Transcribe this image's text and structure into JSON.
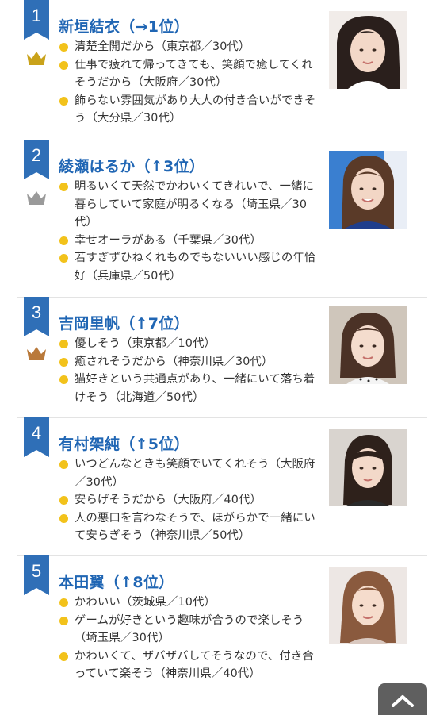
{
  "ranking": [
    {
      "rank": "1",
      "name": "新垣結衣（→1位）",
      "crown": "gold-crown-icon",
      "crown_color": "#c9a21a",
      "photo": "portrait-photo-1",
      "reasons": [
        "清楚全開だから（東京都／30代）",
        "仕事で疲れて帰ってきても、笑顔で癒してくれそうだから（大阪府／30代）",
        "飾らない雰囲気があり大人の付き合いができそう（大分県／30代）"
      ]
    },
    {
      "rank": "2",
      "name": "綾瀬はるか（↑3位）",
      "crown": "silver-crown-icon",
      "crown_color": "#9a9a9a",
      "photo": "portrait-photo-2",
      "reasons": [
        "明るいくて天然でかわいくてきれいで、一緒に暮らしていて家庭が明るくなる（埼玉県／30代）",
        "幸せオーラがある（千葉県／30代）",
        "若すぎずひねくれものでもないいい感じの年恰好（兵庫県／50代）"
      ]
    },
    {
      "rank": "3",
      "name": "吉岡里帆（↑7位）",
      "crown": "bronze-crown-icon",
      "crown_color": "#b9793a",
      "photo": "portrait-photo-3",
      "reasons": [
        "優しそう（東京都／10代）",
        "癒されそうだから（神奈川県／30代）",
        "猫好きという共通点があり、一緒にいて落ち着けそう（北海道／50代）"
      ]
    },
    {
      "rank": "4",
      "name": "有村架純（↑5位）",
      "crown": "",
      "photo": "portrait-photo-4",
      "reasons": [
        "いつどんなときも笑顔でいてくれそう（大阪府／30代）",
        "安らげそうだから（大阪府／40代）",
        "人の悪口を言わなそうで、ほがらかで一緒にいて安らぎそう（神奈川県／50代）"
      ]
    },
    {
      "rank": "5",
      "name": "本田翼（↑8位）",
      "crown": "",
      "photo": "portrait-photo-5",
      "reasons": [
        "かわいい（茨城県／10代）",
        "ゲームが好きという趣味が合うので楽しそう（埼玉県／30代）",
        "かわいくて、ザバザバしてそうなので、付き合っていて楽そう（神奈川県／40代）"
      ]
    }
  ],
  "scroll_top_icon": "chevron-up-icon",
  "colors": {
    "accent_blue": "#2f6fb7",
    "name_blue": "#2066b4",
    "bullet_yellow": "#f2c21b",
    "scroll_button": "#5f5f5f"
  }
}
